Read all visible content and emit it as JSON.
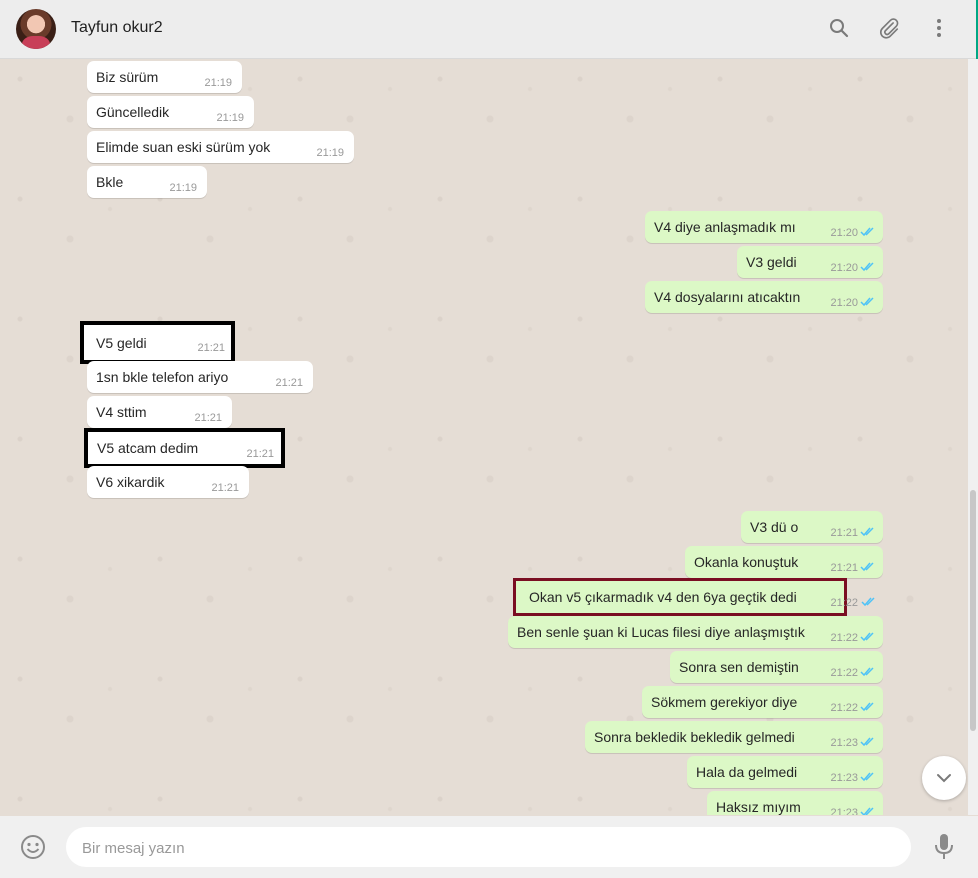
{
  "header": {
    "contact_name": "Tayfun okur2",
    "icons": [
      "search-icon",
      "attach-icon",
      "menu-icon"
    ]
  },
  "messages": [
    {
      "dir": "in",
      "text": "Biz sürüm",
      "time": "21:19"
    },
    {
      "dir": "in",
      "text": "Güncelledik",
      "time": "21:19"
    },
    {
      "dir": "in",
      "text": "Elimde suan eski sürüm yok",
      "time": "21:19"
    },
    {
      "dir": "in",
      "text": "Bkle",
      "time": "21:19"
    },
    {
      "dir": "out",
      "text": "V4 diye anlaşmadık mı",
      "time": "21:20"
    },
    {
      "dir": "out",
      "text": "V3 geldi",
      "time": "21:20"
    },
    {
      "dir": "out",
      "text": "V4 dosyalarını atıcaktın",
      "time": "21:20"
    },
    {
      "dir": "in",
      "text": "V5 geldi",
      "time": "21:21",
      "highlight": "black"
    },
    {
      "dir": "in",
      "text": "1sn bkle telefon ariyo",
      "time": "21:21"
    },
    {
      "dir": "in",
      "text": "V4 sttim",
      "time": "21:21"
    },
    {
      "dir": "in",
      "text": "V5 atcam dedim",
      "time": "21:21",
      "highlight": "black"
    },
    {
      "dir": "in",
      "text": "V6 xikardik",
      "time": "21:21"
    },
    {
      "dir": "out",
      "text": "V3 dü o",
      "time": "21:21"
    },
    {
      "dir": "out",
      "text": "Okanla konuştuk",
      "time": "21:21"
    },
    {
      "dir": "out",
      "text": "Okan v5 çıkarmadık v4 den 6ya geçtik dedi",
      "time": "21:22",
      "highlight": "red"
    },
    {
      "dir": "out",
      "text": "Ben senle şuan ki Lucas filesi diye anlaşmıştık",
      "time": "21:22"
    },
    {
      "dir": "out",
      "text": "Sonra sen demiştin",
      "time": "21:22"
    },
    {
      "dir": "out",
      "text": "Sökmem gerekiyor diye",
      "time": "21:22"
    },
    {
      "dir": "out",
      "text": "Sonra bekledik bekledik gelmedi",
      "time": "21:23"
    },
    {
      "dir": "out",
      "text": "Hala da gelmedi",
      "time": "21:23"
    },
    {
      "dir": "out",
      "text": "Haksız mıyım",
      "time": "21:23"
    }
  ],
  "composer": {
    "placeholder": "Bir mesaj yazın",
    "value": ""
  },
  "colors": {
    "outgoing": "#dcf8c6",
    "incoming": "#ffffff",
    "read_ticks": "#4fc3f7",
    "highlight_red": "#7a0e22"
  }
}
